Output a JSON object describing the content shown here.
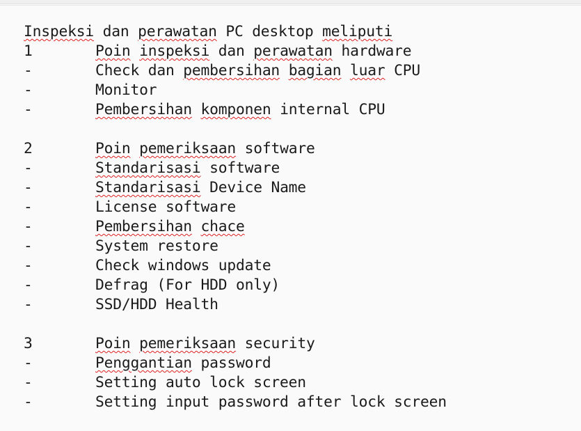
{
  "document": {
    "heading": [
      {
        "t": "Inspeksi",
        "s": true
      },
      {
        "t": " dan ",
        "s": false
      },
      {
        "t": "perawatan",
        "s": true
      },
      {
        "t": " PC desktop ",
        "s": false
      },
      {
        "t": "meliputi",
        "s": true
      }
    ],
    "sections": [
      {
        "number": "1",
        "title": [
          {
            "t": "Poin",
            "s": true
          },
          {
            "t": " ",
            "s": false
          },
          {
            "t": "inspeksi",
            "s": true
          },
          {
            "t": " dan ",
            "s": false
          },
          {
            "t": "perawatan",
            "s": true
          },
          {
            "t": " hardware",
            "s": false
          }
        ],
        "items": [
          [
            {
              "t": "Check dan ",
              "s": false
            },
            {
              "t": "pembersihan",
              "s": true
            },
            {
              "t": " ",
              "s": false
            },
            {
              "t": "bagian",
              "s": true
            },
            {
              "t": " ",
              "s": false
            },
            {
              "t": "luar",
              "s": true
            },
            {
              "t": " CPU",
              "s": false
            }
          ],
          [
            {
              "t": "Monitor",
              "s": false
            }
          ],
          [
            {
              "t": "Pembersihan",
              "s": true
            },
            {
              "t": " ",
              "s": false
            },
            {
              "t": "komponen",
              "s": true
            },
            {
              "t": " internal CPU",
              "s": false
            }
          ]
        ]
      },
      {
        "number": "2",
        "title": [
          {
            "t": "Poin",
            "s": true
          },
          {
            "t": " ",
            "s": false
          },
          {
            "t": "pemeriksaan",
            "s": true
          },
          {
            "t": " software",
            "s": false
          }
        ],
        "items": [
          [
            {
              "t": "Standarisasi",
              "s": true
            },
            {
              "t": " software",
              "s": false
            }
          ],
          [
            {
              "t": "Standarisasi",
              "s": true
            },
            {
              "t": " Device Name",
              "s": false
            }
          ],
          [
            {
              "t": "License software",
              "s": false
            }
          ],
          [
            {
              "t": "Pembersihan",
              "s": true
            },
            {
              "t": " ",
              "s": false
            },
            {
              "t": "chace",
              "s": true
            }
          ],
          [
            {
              "t": "System restore",
              "s": false
            }
          ],
          [
            {
              "t": "Check windows update",
              "s": false
            }
          ],
          [
            {
              "t": "Defrag (For HDD only)",
              "s": false
            }
          ],
          [
            {
              "t": "SSD/HDD Health",
              "s": false
            }
          ]
        ]
      },
      {
        "number": "3",
        "title": [
          {
            "t": "Poin",
            "s": true
          },
          {
            "t": " ",
            "s": false
          },
          {
            "t": "pemeriksaan",
            "s": true
          },
          {
            "t": " security",
            "s": false
          }
        ],
        "items": [
          [
            {
              "t": "Penggantian",
              "s": true
            },
            {
              "t": " password",
              "s": false
            }
          ],
          [
            {
              "t": "Setting auto lock screen",
              "s": false
            }
          ],
          [
            {
              "t": "Setting input password after lock screen",
              "s": false
            }
          ]
        ]
      }
    ],
    "bullet": "-"
  },
  "colors": {
    "text": "#1a1a1a",
    "spellcheck_underline": "#e0201f",
    "background": "#fafafa"
  }
}
